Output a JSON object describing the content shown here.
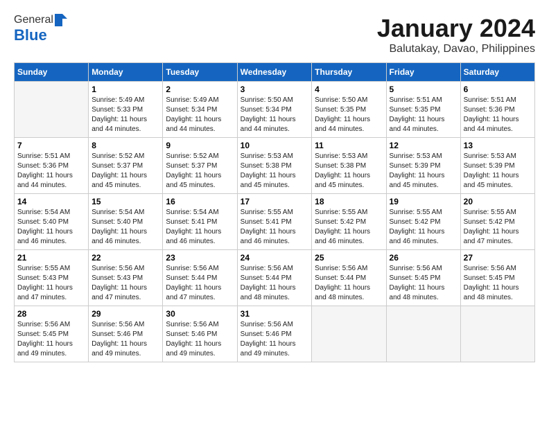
{
  "logo": {
    "general": "General",
    "blue": "Blue"
  },
  "title": "January 2024",
  "location": "Balutakay, Davao, Philippines",
  "headers": [
    "Sunday",
    "Monday",
    "Tuesday",
    "Wednesday",
    "Thursday",
    "Friday",
    "Saturday"
  ],
  "weeks": [
    [
      {
        "day": "",
        "sunrise": "",
        "sunset": "",
        "daylight": "",
        "empty": true
      },
      {
        "day": "1",
        "sunrise": "Sunrise: 5:49 AM",
        "sunset": "Sunset: 5:33 PM",
        "daylight": "Daylight: 11 hours and 44 minutes.",
        "empty": false
      },
      {
        "day": "2",
        "sunrise": "Sunrise: 5:49 AM",
        "sunset": "Sunset: 5:34 PM",
        "daylight": "Daylight: 11 hours and 44 minutes.",
        "empty": false
      },
      {
        "day": "3",
        "sunrise": "Sunrise: 5:50 AM",
        "sunset": "Sunset: 5:34 PM",
        "daylight": "Daylight: 11 hours and 44 minutes.",
        "empty": false
      },
      {
        "day": "4",
        "sunrise": "Sunrise: 5:50 AM",
        "sunset": "Sunset: 5:35 PM",
        "daylight": "Daylight: 11 hours and 44 minutes.",
        "empty": false
      },
      {
        "day": "5",
        "sunrise": "Sunrise: 5:51 AM",
        "sunset": "Sunset: 5:35 PM",
        "daylight": "Daylight: 11 hours and 44 minutes.",
        "empty": false
      },
      {
        "day": "6",
        "sunrise": "Sunrise: 5:51 AM",
        "sunset": "Sunset: 5:36 PM",
        "daylight": "Daylight: 11 hours and 44 minutes.",
        "empty": false
      }
    ],
    [
      {
        "day": "7",
        "sunrise": "Sunrise: 5:51 AM",
        "sunset": "Sunset: 5:36 PM",
        "daylight": "Daylight: 11 hours and 44 minutes.",
        "empty": false
      },
      {
        "day": "8",
        "sunrise": "Sunrise: 5:52 AM",
        "sunset": "Sunset: 5:37 PM",
        "daylight": "Daylight: 11 hours and 45 minutes.",
        "empty": false
      },
      {
        "day": "9",
        "sunrise": "Sunrise: 5:52 AM",
        "sunset": "Sunset: 5:37 PM",
        "daylight": "Daylight: 11 hours and 45 minutes.",
        "empty": false
      },
      {
        "day": "10",
        "sunrise": "Sunrise: 5:53 AM",
        "sunset": "Sunset: 5:38 PM",
        "daylight": "Daylight: 11 hours and 45 minutes.",
        "empty": false
      },
      {
        "day": "11",
        "sunrise": "Sunrise: 5:53 AM",
        "sunset": "Sunset: 5:38 PM",
        "daylight": "Daylight: 11 hours and 45 minutes.",
        "empty": false
      },
      {
        "day": "12",
        "sunrise": "Sunrise: 5:53 AM",
        "sunset": "Sunset: 5:39 PM",
        "daylight": "Daylight: 11 hours and 45 minutes.",
        "empty": false
      },
      {
        "day": "13",
        "sunrise": "Sunrise: 5:53 AM",
        "sunset": "Sunset: 5:39 PM",
        "daylight": "Daylight: 11 hours and 45 minutes.",
        "empty": false
      }
    ],
    [
      {
        "day": "14",
        "sunrise": "Sunrise: 5:54 AM",
        "sunset": "Sunset: 5:40 PM",
        "daylight": "Daylight: 11 hours and 46 minutes.",
        "empty": false
      },
      {
        "day": "15",
        "sunrise": "Sunrise: 5:54 AM",
        "sunset": "Sunset: 5:40 PM",
        "daylight": "Daylight: 11 hours and 46 minutes.",
        "empty": false
      },
      {
        "day": "16",
        "sunrise": "Sunrise: 5:54 AM",
        "sunset": "Sunset: 5:41 PM",
        "daylight": "Daylight: 11 hours and 46 minutes.",
        "empty": false
      },
      {
        "day": "17",
        "sunrise": "Sunrise: 5:55 AM",
        "sunset": "Sunset: 5:41 PM",
        "daylight": "Daylight: 11 hours and 46 minutes.",
        "empty": false
      },
      {
        "day": "18",
        "sunrise": "Sunrise: 5:55 AM",
        "sunset": "Sunset: 5:42 PM",
        "daylight": "Daylight: 11 hours and 46 minutes.",
        "empty": false
      },
      {
        "day": "19",
        "sunrise": "Sunrise: 5:55 AM",
        "sunset": "Sunset: 5:42 PM",
        "daylight": "Daylight: 11 hours and 46 minutes.",
        "empty": false
      },
      {
        "day": "20",
        "sunrise": "Sunrise: 5:55 AM",
        "sunset": "Sunset: 5:42 PM",
        "daylight": "Daylight: 11 hours and 47 minutes.",
        "empty": false
      }
    ],
    [
      {
        "day": "21",
        "sunrise": "Sunrise: 5:55 AM",
        "sunset": "Sunset: 5:43 PM",
        "daylight": "Daylight: 11 hours and 47 minutes.",
        "empty": false
      },
      {
        "day": "22",
        "sunrise": "Sunrise: 5:56 AM",
        "sunset": "Sunset: 5:43 PM",
        "daylight": "Daylight: 11 hours and 47 minutes.",
        "empty": false
      },
      {
        "day": "23",
        "sunrise": "Sunrise: 5:56 AM",
        "sunset": "Sunset: 5:44 PM",
        "daylight": "Daylight: 11 hours and 47 minutes.",
        "empty": false
      },
      {
        "day": "24",
        "sunrise": "Sunrise: 5:56 AM",
        "sunset": "Sunset: 5:44 PM",
        "daylight": "Daylight: 11 hours and 48 minutes.",
        "empty": false
      },
      {
        "day": "25",
        "sunrise": "Sunrise: 5:56 AM",
        "sunset": "Sunset: 5:44 PM",
        "daylight": "Daylight: 11 hours and 48 minutes.",
        "empty": false
      },
      {
        "day": "26",
        "sunrise": "Sunrise: 5:56 AM",
        "sunset": "Sunset: 5:45 PM",
        "daylight": "Daylight: 11 hours and 48 minutes.",
        "empty": false
      },
      {
        "day": "27",
        "sunrise": "Sunrise: 5:56 AM",
        "sunset": "Sunset: 5:45 PM",
        "daylight": "Daylight: 11 hours and 48 minutes.",
        "empty": false
      }
    ],
    [
      {
        "day": "28",
        "sunrise": "Sunrise: 5:56 AM",
        "sunset": "Sunset: 5:45 PM",
        "daylight": "Daylight: 11 hours and 49 minutes.",
        "empty": false
      },
      {
        "day": "29",
        "sunrise": "Sunrise: 5:56 AM",
        "sunset": "Sunset: 5:46 PM",
        "daylight": "Daylight: 11 hours and 49 minutes.",
        "empty": false
      },
      {
        "day": "30",
        "sunrise": "Sunrise: 5:56 AM",
        "sunset": "Sunset: 5:46 PM",
        "daylight": "Daylight: 11 hours and 49 minutes.",
        "empty": false
      },
      {
        "day": "31",
        "sunrise": "Sunrise: 5:56 AM",
        "sunset": "Sunset: 5:46 PM",
        "daylight": "Daylight: 11 hours and 49 minutes.",
        "empty": false
      },
      {
        "day": "",
        "sunrise": "",
        "sunset": "",
        "daylight": "",
        "empty": true
      },
      {
        "day": "",
        "sunrise": "",
        "sunset": "",
        "daylight": "",
        "empty": true
      },
      {
        "day": "",
        "sunrise": "",
        "sunset": "",
        "daylight": "",
        "empty": true
      }
    ]
  ]
}
